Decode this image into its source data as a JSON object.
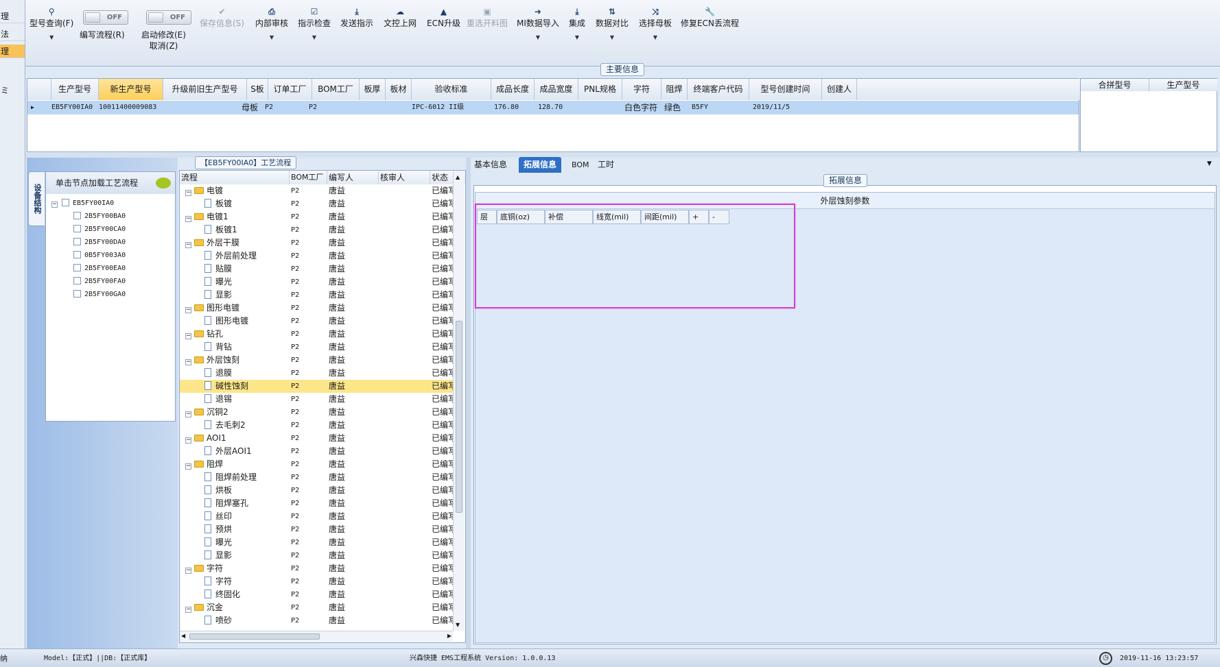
{
  "left_strip": {
    "items": [
      {
        "label": "理"
      },
      {
        "label": "法"
      },
      {
        "label": "理"
      },
      {
        "label": "ミ"
      }
    ]
  },
  "toolbar": {
    "items": [
      {
        "icon": "search-icon",
        "label": "型号查询(F)"
      },
      {
        "toggle": "OFF",
        "label": "编写流程(R)"
      },
      {
        "toggle": "OFF",
        "label": "启动修改(E)",
        "label2": "取消(Z)"
      },
      {
        "icon": "check-icon",
        "label": "保存信息(S)"
      },
      {
        "icon": "print-icon",
        "label": "内部审核"
      },
      {
        "icon": "checkbox-icon",
        "label": "指示检查"
      },
      {
        "icon": "upload-icon",
        "label": "发送指示"
      },
      {
        "icon": "cloud-upload-icon",
        "label": "文控上网"
      },
      {
        "icon": "upgrade-icon",
        "label": "ECN升级"
      },
      {
        "icon": "image-icon",
        "label": "重选开料图"
      },
      {
        "icon": "import-icon",
        "label": "MI数据导入"
      },
      {
        "icon": "download-icon",
        "label": "集成"
      },
      {
        "icon": "compare-icon",
        "label": "数据对比"
      },
      {
        "icon": "shuffle-icon",
        "label": "选择母板"
      },
      {
        "icon": "wrench-icon",
        "label": "修复ECN丢流程"
      }
    ]
  },
  "main_info": {
    "title": "主要信息",
    "columns": [
      "生产型号",
      "新生产型号",
      "升级前旧生产型号",
      "S板",
      "订单工厂",
      "BOM工厂",
      "板厚",
      "板材",
      "验收标准",
      "成品长度",
      "成品宽度",
      "PNL规格",
      "字符",
      "阻焊",
      "终端客户代码",
      "型号创建时间",
      "创建人"
    ],
    "row": [
      "EB5FY00IA0",
      "10011400009083",
      "",
      "母板",
      "P2",
      "P2",
      "",
      "",
      "IPC-6012 II级",
      "176.80",
      "128.70",
      "",
      "白色字符",
      "绿色",
      "B5FY",
      "2019/11/5",
      ""
    ],
    "right_columns": [
      "合拼型号",
      "生产型号"
    ]
  },
  "device_panel": {
    "tab_label": "设备结构",
    "header": "单击节点加载工艺流程",
    "root": "EB5FY00IA0",
    "children": [
      "2B5FY00BA0",
      "2B5FY00CA0",
      "2B5FY00DA0",
      "0B5FY003A0",
      "2B5FY00EA0",
      "2B5FY00FA0",
      "2B5FY00GA0"
    ]
  },
  "flow_panel": {
    "title": "【EB5FY00IA0】工艺流程",
    "columns": [
      "流程",
      "BOM工厂",
      "编写人",
      "核审人",
      "状态"
    ],
    "rows": [
      {
        "name": "电镀",
        "type": "folder",
        "bom": "P2",
        "writer": "唐益",
        "status": "已编写"
      },
      {
        "name": "板镀",
        "type": "doc",
        "bom": "P2",
        "writer": "唐益",
        "status": "已编写"
      },
      {
        "name": "电镀1",
        "type": "folder",
        "bom": "P2",
        "writer": "唐益",
        "status": "已编写"
      },
      {
        "name": "板镀1",
        "type": "doc",
        "bom": "P2",
        "writer": "唐益",
        "status": "已编写"
      },
      {
        "name": "外层干膜",
        "type": "folder",
        "bom": "P2",
        "writer": "唐益",
        "status": "已编写"
      },
      {
        "name": "外层前处理",
        "type": "doc",
        "bom": "P2",
        "writer": "唐益",
        "status": "已编写"
      },
      {
        "name": "贴膜",
        "type": "doc",
        "bom": "P2",
        "writer": "唐益",
        "status": "已编写"
      },
      {
        "name": "曝光",
        "type": "doc",
        "bom": "P2",
        "writer": "唐益",
        "status": "已编写"
      },
      {
        "name": "显影",
        "type": "doc",
        "bom": "P2",
        "writer": "唐益",
        "status": "已编写"
      },
      {
        "name": "图形电镀",
        "type": "folder",
        "bom": "P2",
        "writer": "唐益",
        "status": "已编写"
      },
      {
        "name": "图形电镀",
        "type": "doc",
        "bom": "P2",
        "writer": "唐益",
        "status": "已编写"
      },
      {
        "name": "钻孔",
        "type": "folder",
        "bom": "P2",
        "writer": "唐益",
        "status": "已编写"
      },
      {
        "name": "背钻",
        "type": "doc",
        "bom": "P2",
        "writer": "唐益",
        "status": "已编写"
      },
      {
        "name": "外层蚀刻",
        "type": "folder",
        "bom": "P2",
        "writer": "唐益",
        "status": "已编写"
      },
      {
        "name": "退膜",
        "type": "doc",
        "bom": "P2",
        "writer": "唐益",
        "status": "已编写"
      },
      {
        "name": "碱性蚀刻",
        "type": "doc",
        "bom": "P2",
        "writer": "唐益",
        "status": "已编写",
        "selected": true
      },
      {
        "name": "退锡",
        "type": "doc",
        "bom": "P2",
        "writer": "唐益",
        "status": "已编写"
      },
      {
        "name": "沉铜2",
        "type": "folder",
        "bom": "P2",
        "writer": "唐益",
        "status": "已编写"
      },
      {
        "name": "去毛刺2",
        "type": "doc",
        "bom": "P2",
        "writer": "唐益",
        "status": "已编写"
      },
      {
        "name": "AOI1",
        "type": "folder",
        "bom": "P2",
        "writer": "唐益",
        "status": "已编写"
      },
      {
        "name": "外层AOI1",
        "type": "doc",
        "bom": "P2",
        "writer": "唐益",
        "status": "已编写"
      },
      {
        "name": "阻焊",
        "type": "folder",
        "bom": "P2",
        "writer": "唐益",
        "status": "已编写"
      },
      {
        "name": "阻焊前处理",
        "type": "doc",
        "bom": "P2",
        "writer": "唐益",
        "status": "已编写"
      },
      {
        "name": "烘板",
        "type": "doc",
        "bom": "P2",
        "writer": "唐益",
        "status": "已编写"
      },
      {
        "name": "阻焊塞孔",
        "type": "doc",
        "bom": "P2",
        "writer": "唐益",
        "status": "已编写"
      },
      {
        "name": "丝印",
        "type": "doc",
        "bom": "P2",
        "writer": "唐益",
        "status": "已编写"
      },
      {
        "name": "预烘",
        "type": "doc",
        "bom": "P2",
        "writer": "唐益",
        "status": "已编写"
      },
      {
        "name": "曝光",
        "type": "doc",
        "bom": "P2",
        "writer": "唐益",
        "status": "已编写"
      },
      {
        "name": "显影",
        "type": "doc",
        "bom": "P2",
        "writer": "唐益",
        "status": "已编写"
      },
      {
        "name": "字符",
        "type": "folder",
        "bom": "P2",
        "writer": "唐益",
        "status": "已编写"
      },
      {
        "name": "字符",
        "type": "doc",
        "bom": "P2",
        "writer": "唐益",
        "status": "已编写"
      },
      {
        "name": "终固化",
        "type": "doc",
        "bom": "P2",
        "writer": "唐益",
        "status": "已编写"
      },
      {
        "name": "沉金",
        "type": "folder",
        "bom": "P2",
        "writer": "唐益",
        "status": "已编写"
      },
      {
        "name": "喷砂",
        "type": "doc",
        "bom": "P2",
        "writer": "唐益",
        "status": "已编写"
      }
    ]
  },
  "right_panel": {
    "tabs": [
      "基本信息",
      "拓展信息",
      "BOM",
      "工时"
    ],
    "active_tab": "拓展信息",
    "group_title": "拓展信息",
    "section_title": "外层蚀刻参数",
    "param_columns": [
      "层",
      "底铜(oz)",
      "补偿",
      "线宽(mil)",
      "间距(mil)",
      "+",
      "-"
    ]
  },
  "status_bar": {
    "left": "纳",
    "model": "Model:【正式】||DB:【正式库】",
    "app": "兴森快捷 EMS工程系统 Version: 1.0.0.13",
    "datetime": "2019-11-16 13:23:57"
  },
  "colors": {
    "accent": "#2f6fc6",
    "highlight": "#fbcf5c",
    "selection": "#fde68a",
    "callout": "#d13ed1"
  }
}
